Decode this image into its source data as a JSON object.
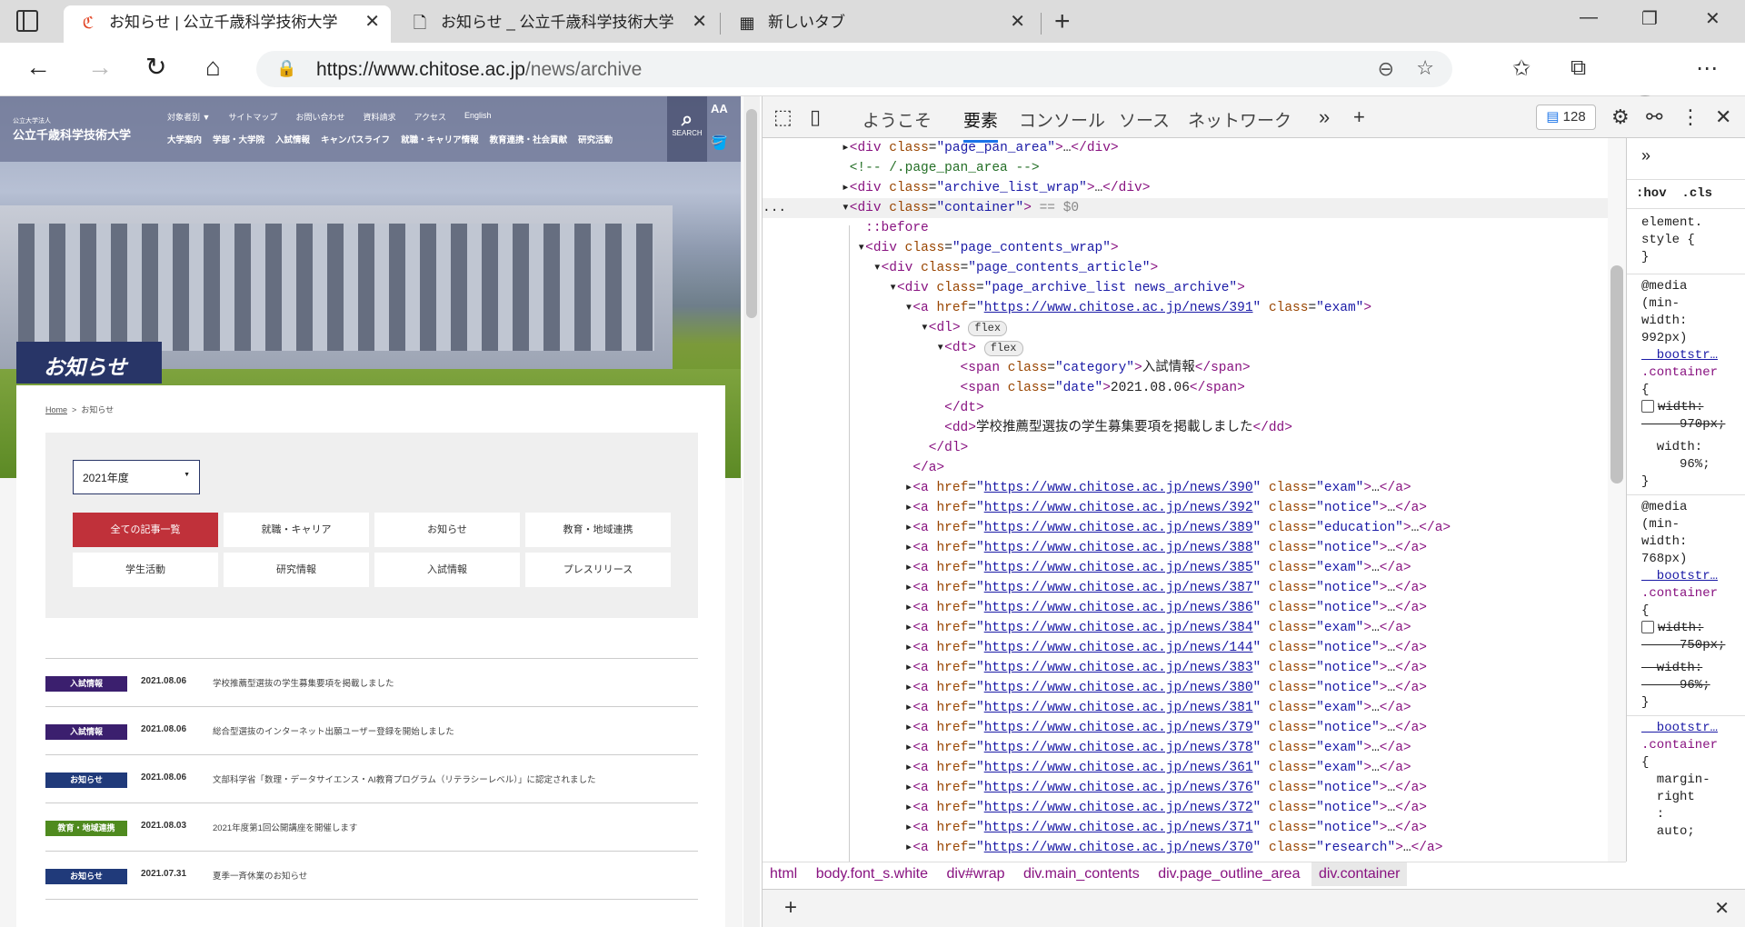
{
  "browser": {
    "tabs": [
      {
        "title": "お知らせ | 公立千歳科学技術大学",
        "active": true
      },
      {
        "title": "お知らせ _ 公立千歳科学技術大学",
        "active": false
      },
      {
        "title": "新しいタブ",
        "active": false
      }
    ],
    "url_host": "https://www.chitose.ac.jp",
    "url_path": "/news/archive"
  },
  "site": {
    "logo_sub": "公立大学法人",
    "logo": "公立千歳科学技術大学",
    "topnav": [
      "対象者別 ▼",
      "サイトマップ",
      "お問い合わせ",
      "資料請求",
      "アクセス",
      "English"
    ],
    "mainnav": [
      "大学案内",
      "学部・大学院",
      "入試情報",
      "キャンパスライフ",
      "就職・キャリア情報",
      "教育連携・社会貢献",
      "研究活動"
    ],
    "search": "SEARCH",
    "aa": "AA",
    "page_title": "お知らせ",
    "crumb_home": "Home",
    "crumb_sep": ">",
    "crumb_current": "お知らせ",
    "year": "2021年度",
    "categories": [
      "全ての記事一覧",
      "就職・キャリア",
      "お知らせ",
      "教育・地域連携",
      "学生活動",
      "研究情報",
      "入試情報",
      "プレスリリース"
    ],
    "news": [
      {
        "badge": "入試情報",
        "color": "#3b1f6e",
        "date": "2021.08.06",
        "title": "学校推薦型選抜の学生募集要項を掲載しました"
      },
      {
        "badge": "入試情報",
        "color": "#3b1f6e",
        "date": "2021.08.06",
        "title": "総合型選抜のインターネット出願ユーザー登録を開始しました"
      },
      {
        "badge": "お知らせ",
        "color": "#203a7a",
        "date": "2021.08.06",
        "title": "文部科学省「数理・データサイエンス・AI教育プログラム（リテラシーレベル）」に認定されました"
      },
      {
        "badge": "教育・地域連携",
        "color": "#4f8a1f",
        "date": "2021.08.03",
        "title": "2021年度第1回公開講座を開催します"
      },
      {
        "badge": "お知らせ",
        "color": "#203a7a",
        "date": "2021.07.31",
        "title": "夏季一斉休業のお知らせ"
      }
    ]
  },
  "devtools": {
    "tabs": [
      "ようこそ",
      "要素",
      "コンソール",
      "ソース",
      "ネットワーク"
    ],
    "issues": "128",
    "ellipsis": "...",
    "styles": {
      "hov": ":hov",
      "cls": ".cls"
    },
    "breadcrumbs": [
      "html",
      "body.font_s.white",
      "div#wrap",
      "div.main_contents",
      "div.page_outline_area",
      "div.container"
    ]
  }
}
